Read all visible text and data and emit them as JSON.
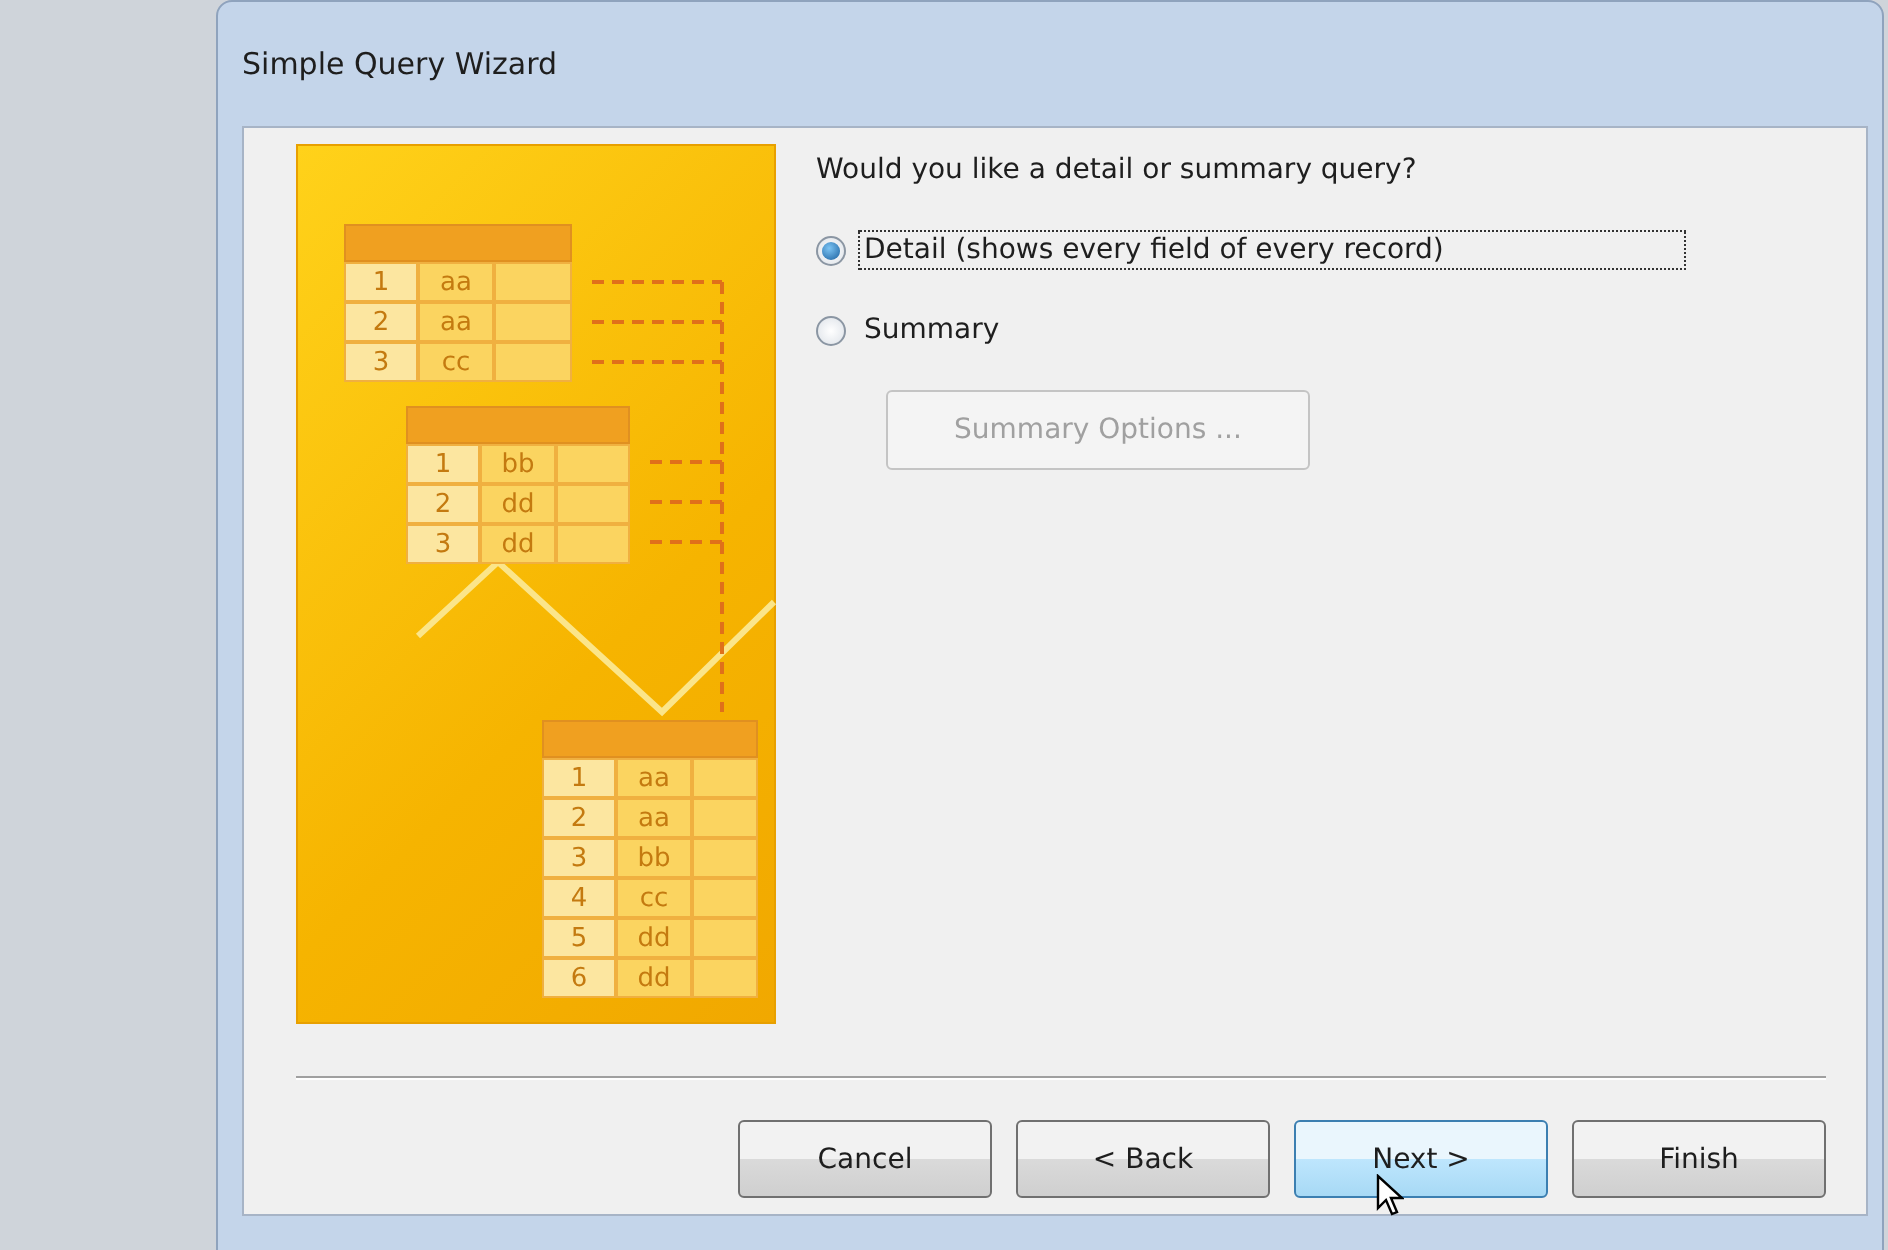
{
  "window": {
    "title": "Simple Query Wizard"
  },
  "illustration": {
    "tables": [
      {
        "rows": [
          [
            "1",
            "aa"
          ],
          [
            "2",
            "aa"
          ],
          [
            "3",
            "cc"
          ]
        ]
      },
      {
        "rows": [
          [
            "1",
            "bb"
          ],
          [
            "2",
            "dd"
          ],
          [
            "3",
            "dd"
          ]
        ]
      },
      {
        "rows": [
          [
            "1",
            "aa"
          ],
          [
            "2",
            "aa"
          ],
          [
            "3",
            "bb"
          ],
          [
            "4",
            "cc"
          ],
          [
            "5",
            "dd"
          ],
          [
            "6",
            "dd"
          ]
        ]
      }
    ]
  },
  "question": "Would you like a detail or summary query?",
  "options": [
    {
      "label": "Detail (shows every field of every record)",
      "selected": true,
      "focused": true
    },
    {
      "label": "Summary",
      "selected": false,
      "focused": false
    }
  ],
  "summary_options_button": {
    "label": "Summary Options ...",
    "disabled": true
  },
  "buttons": [
    {
      "label": "Cancel",
      "highlighted": false
    },
    {
      "label": "< Back",
      "highlighted": false
    },
    {
      "label": "Next >",
      "highlighted": true
    },
    {
      "label": "Finish",
      "highlighted": false
    }
  ]
}
